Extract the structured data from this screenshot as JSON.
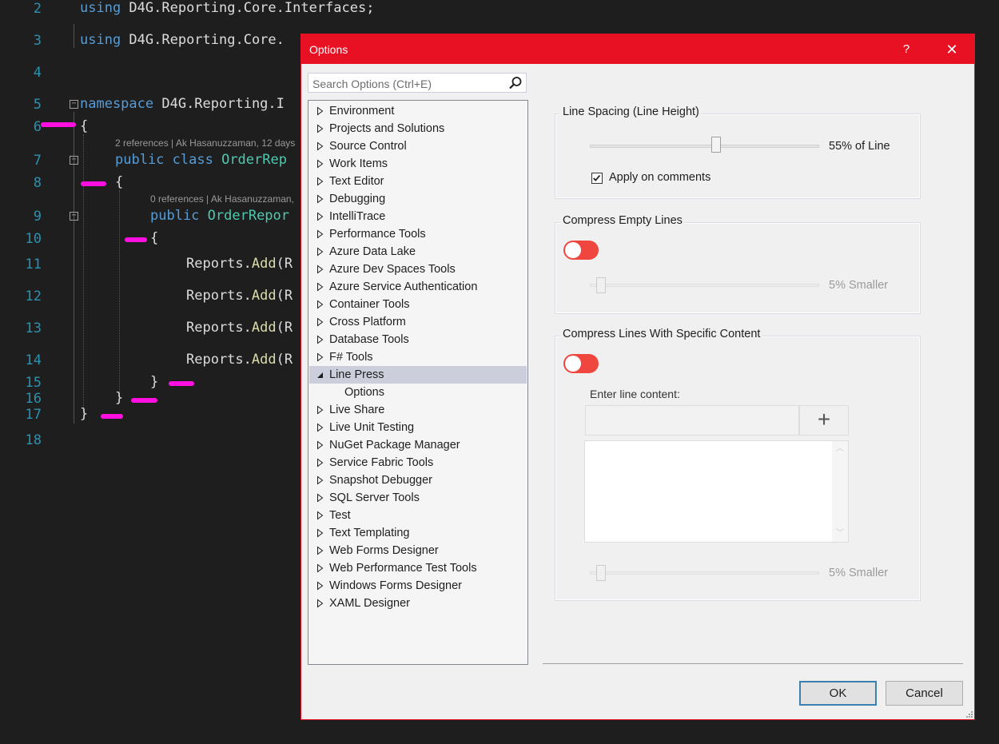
{
  "editor": {
    "line_numbers": [
      "2",
      "3",
      "4",
      "5",
      "6",
      "7",
      "8",
      "9",
      "10",
      "11",
      "12",
      "13",
      "14",
      "15",
      "16",
      "17",
      "18"
    ],
    "lines": {
      "l2_kw": "using",
      "l2_rest": " D4G.Reporting.Core.Interfaces;",
      "l3_kw": "using",
      "l3_rest": " D4G.Reporting.Core.",
      "l5_kw": "namespace",
      "l5_rest": " D4G.Reporting.I",
      "brace_open": "{",
      "brace_close": "}",
      "l7_kw1": "public",
      "l7_kw2": " class",
      "l7_type": " OrderRep",
      "l9_kw": "public",
      "l9_type": " OrderRepor",
      "reports_obj": "Reports",
      "reports_dot": ".",
      "reports_method": "Add",
      "reports_paren": "(R"
    },
    "codelens": [
      "2 references | Ak Hasanuzzaman, 12 days",
      "0 references | Ak Hasanuzzaman,"
    ],
    "fold_glyph": "−"
  },
  "dialog": {
    "title": "Options",
    "help_label": "?",
    "close_label": "✕",
    "search": {
      "placeholder": "Search Options (Ctrl+E)",
      "value": ""
    },
    "tree": [
      {
        "label": "Environment",
        "expanded": false
      },
      {
        "label": "Projects and Solutions",
        "expanded": false
      },
      {
        "label": "Source Control",
        "expanded": false
      },
      {
        "label": "Work Items",
        "expanded": false
      },
      {
        "label": "Text Editor",
        "expanded": false
      },
      {
        "label": "Debugging",
        "expanded": false
      },
      {
        "label": "IntelliTrace",
        "expanded": false
      },
      {
        "label": "Performance Tools",
        "expanded": false
      },
      {
        "label": "Azure Data Lake",
        "expanded": false
      },
      {
        "label": "Azure Dev Spaces Tools",
        "expanded": false
      },
      {
        "label": "Azure Service Authentication",
        "expanded": false
      },
      {
        "label": "Container Tools",
        "expanded": false
      },
      {
        "label": "Cross Platform",
        "expanded": false
      },
      {
        "label": "Database Tools",
        "expanded": false
      },
      {
        "label": "F# Tools",
        "expanded": false
      },
      {
        "label": "Line Press",
        "expanded": true,
        "selected": true
      },
      {
        "label": "Options",
        "child": true
      },
      {
        "label": "Live Share",
        "expanded": false
      },
      {
        "label": "Live Unit Testing",
        "expanded": false
      },
      {
        "label": "NuGet Package Manager",
        "expanded": false
      },
      {
        "label": "Service Fabric Tools",
        "expanded": false
      },
      {
        "label": "Snapshot Debugger",
        "expanded": false
      },
      {
        "label": "SQL Server Tools",
        "expanded": false
      },
      {
        "label": "Test",
        "expanded": false
      },
      {
        "label": "Text Templating",
        "expanded": false
      },
      {
        "label": "Web Forms Designer",
        "expanded": false
      },
      {
        "label": "Web Performance Test Tools",
        "expanded": false
      },
      {
        "label": "Windows Forms Designer",
        "expanded": false
      },
      {
        "label": "XAML Designer",
        "expanded": false
      }
    ],
    "line_spacing": {
      "title": "Line Spacing (Line Height)",
      "slider_value_label": "55% of Line",
      "slider_fraction": 0.55,
      "apply_comments_label": "Apply on comments",
      "apply_comments_checked": true
    },
    "compress_empty": {
      "title": "Compress Empty Lines",
      "toggle_on": false,
      "slider_value_label": "5% Smaller",
      "slider_fraction": 0.05
    },
    "compress_specific": {
      "title": "Compress Lines With Specific Content",
      "toggle_on": false,
      "enter_label": "Enter line content:",
      "input_value": "",
      "add_label": "+",
      "slider_value_label": "5% Smaller",
      "slider_fraction": 0.05
    },
    "ok_label": "OK",
    "cancel_label": "Cancel",
    "colors": {
      "accent": "#e81123",
      "toggle": "#f04640",
      "selection": "#cccedb"
    }
  }
}
